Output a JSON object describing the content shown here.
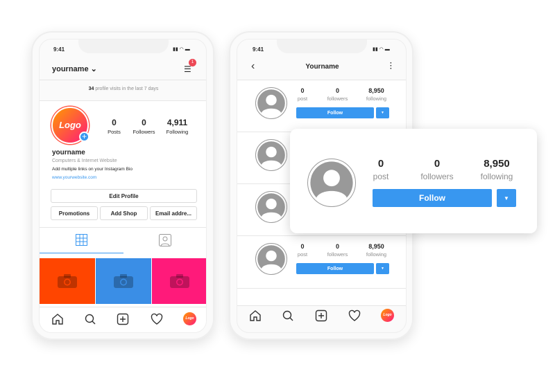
{
  "status_time": "9:41",
  "profile": {
    "username": "yourname",
    "badge": "1",
    "visits_count": "34",
    "visits_text": " profile visits in the last 7 days",
    "logo": "Logo",
    "stats": [
      {
        "value": "0",
        "label": "Posts"
      },
      {
        "value": "0",
        "label": "Followers"
      },
      {
        "value": "4,911",
        "label": "Following"
      }
    ],
    "name": "yourname",
    "category": "Computers & Internet Website",
    "bio": "Add multiple links on your Instagram Bio",
    "website": "www.yourwebsite.com",
    "edit_profile": "Edit Profile",
    "buttons": [
      "Promotions",
      "Add Shop",
      "Email addre..."
    ],
    "grid_colors": [
      "#ff4500",
      "#3a8ee6",
      "#ff1a7a"
    ]
  },
  "list": {
    "title": "Yourname",
    "rows": [
      {
        "post": "0",
        "followers": "0",
        "following": "8,950"
      },
      {
        "post": "0",
        "followers": "0",
        "following": "8,950"
      }
    ],
    "labels": {
      "post": "post",
      "followers": "followers",
      "following": "following"
    },
    "follow": "Follow"
  },
  "card": {
    "post": "0",
    "followers": "0",
    "following": "8,950",
    "labels": {
      "post": "post",
      "followers": "followers",
      "following": "following"
    },
    "follow": "Follow"
  },
  "colors": {
    "accent": "#3897f0",
    "badge": "#ed4956"
  }
}
